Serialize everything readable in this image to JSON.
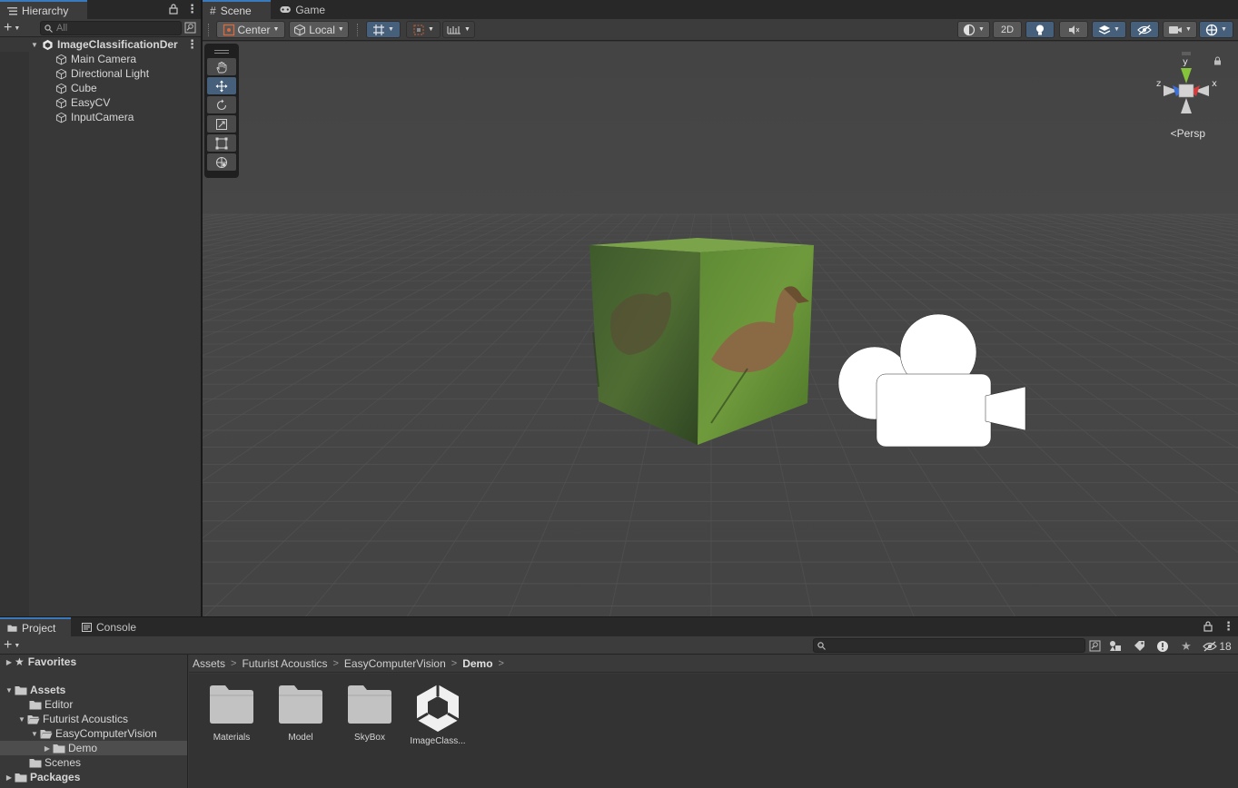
{
  "hierarchy": {
    "tab_label": "Hierarchy",
    "search_placeholder": "All",
    "scene_name": "ImageClassificationDer",
    "items": [
      {
        "label": "Main Camera"
      },
      {
        "label": "Directional Light"
      },
      {
        "label": "Cube"
      },
      {
        "label": "EasyCV"
      },
      {
        "label": "InputCamera"
      }
    ]
  },
  "scene_tabs": {
    "scene_label": "Scene",
    "game_label": "Game"
  },
  "scene_toolbar": {
    "pivot_label": "Center",
    "space_label": "Local",
    "mode_2d_label": "2D",
    "projection_label": "Persp"
  },
  "gizmo_axes": {
    "y": "y",
    "z": "z",
    "x": "x"
  },
  "project": {
    "tab_label": "Project",
    "console_label": "Console",
    "hidden_count": "18",
    "tree": {
      "favorites": "Favorites",
      "assets": "Assets",
      "editor": "Editor",
      "futurist": "Futurist Acoustics",
      "easycv": "EasyComputerVision",
      "demo": "Demo",
      "scenes": "Scenes",
      "packages": "Packages"
    },
    "breadcrumb": [
      "Assets",
      "Futurist Acoustics",
      "EasyComputerVision",
      "Demo"
    ],
    "assets": [
      {
        "label": "Materials",
        "icon": "folder-icon"
      },
      {
        "label": "Model",
        "icon": "folder-icon"
      },
      {
        "label": "SkyBox",
        "icon": "folder-icon"
      },
      {
        "label": "ImageClass...",
        "icon": "unity-scene-icon"
      }
    ]
  },
  "colors": {
    "selection_blue": "#46607c",
    "tab_accent": "#3a79bb",
    "viewport_bg": "#474747"
  }
}
